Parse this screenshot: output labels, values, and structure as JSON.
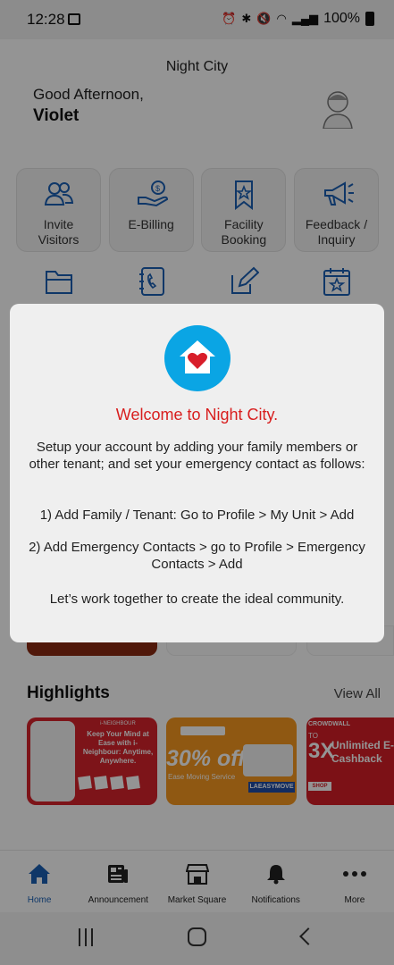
{
  "status_bar": {
    "time": "12:28",
    "battery": "100%"
  },
  "header": {
    "city": "Night City",
    "greeting": "Good Afternoon,",
    "user_name": "Violet"
  },
  "quick_actions": [
    {
      "label": "Invite\nVisitors",
      "icon": "people-icon"
    },
    {
      "label": "E-Billing",
      "icon": "bill-hand-icon"
    },
    {
      "label": "Facility\nBooking",
      "icon": "bookmark-star-icon"
    },
    {
      "label": "Feedback /\nInquiry",
      "icon": "megaphone-icon"
    }
  ],
  "quick_actions_row2": [
    {
      "icon": "folder-icon"
    },
    {
      "icon": "contacts-book-icon"
    },
    {
      "icon": "edit-icon"
    },
    {
      "icon": "calendar-star-icon"
    }
  ],
  "highlights": {
    "title": "Highlights",
    "view_all": "View All",
    "cards": [
      {
        "headline": "Keep Your Mind at Ease with i-Neighbour: Anytime, Anywhere.",
        "badge": "i-NEIGHBOUR"
      },
      {
        "headline": "30% off",
        "sub": "Ease Moving Service",
        "code": "LAEASYMOVE"
      },
      {
        "logo": "CROWDWALL",
        "prefix": "TO",
        "big": "3X",
        "headline": "Unlimited E-Cashback",
        "button": "SHOP NOW"
      }
    ]
  },
  "bottom_nav": [
    {
      "label": "Home",
      "icon": "home-icon",
      "active": true
    },
    {
      "label": "Announcement",
      "icon": "newspaper-icon",
      "active": false
    },
    {
      "label": "Market Square",
      "icon": "store-icon",
      "active": false
    },
    {
      "label": "Notifications",
      "icon": "bell-icon",
      "active": false
    },
    {
      "label": "More",
      "icon": "more-dots-icon",
      "active": false
    }
  ],
  "dialog": {
    "icon": "home-heart-icon",
    "title": "Welcome to Night City.",
    "line1": "Setup your account by adding your family members or other tenant; and set your emergency contact as follows:",
    "line2": "1) Add Family / Tenant: Go to Profile > My Unit > Add",
    "line3": "2) Add Emergency Contacts > go to Profile > Emergency Contacts > Add",
    "line4": "Let’s work together to create the ideal community."
  },
  "colors": {
    "accent_blue": "#1a5fb4",
    "dialog_title_red": "#d81e1e",
    "dialog_icon_bg": "#0aa5e4"
  }
}
